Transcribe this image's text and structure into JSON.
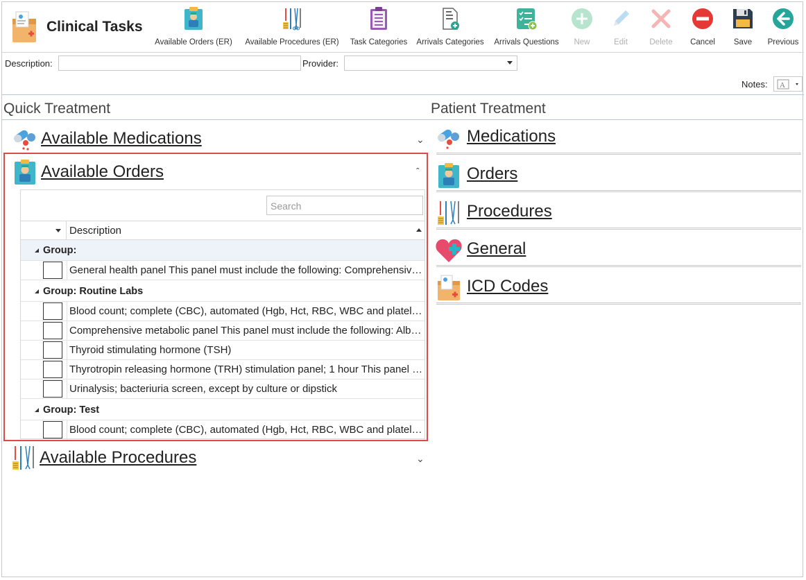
{
  "app": {
    "title": "Clinical Tasks"
  },
  "toolbar": {
    "buttons": [
      {
        "label": "Available Orders (ER)",
        "icon": "orders-clipboard-icon"
      },
      {
        "label": "Available Procedures (ER)",
        "icon": "surgical-tools-icon"
      },
      {
        "label": "Task Categories",
        "icon": "list-clipboard-icon"
      },
      {
        "label": "Arrivals Categories",
        "icon": "document-add-icon"
      },
      {
        "label": "Arrivals Questions",
        "icon": "checklist-add-icon"
      },
      {
        "label": "New",
        "icon": "plus-circle-icon",
        "enabled": false
      },
      {
        "label": "Edit",
        "icon": "pencil-icon",
        "enabled": false
      },
      {
        "label": "Delete",
        "icon": "x-icon",
        "enabled": false
      },
      {
        "label": "Cancel",
        "icon": "minus-circle-icon",
        "enabled": true
      },
      {
        "label": "Save",
        "icon": "floppy-disk-icon",
        "enabled": true
      },
      {
        "label": "Previous",
        "icon": "arrow-left-circle-icon",
        "enabled": true
      }
    ]
  },
  "filters": {
    "description_label": "Description:",
    "description_value": "",
    "provider_label": "Provider:",
    "provider_value": "",
    "notes_label": "Notes:"
  },
  "quick_treatment": {
    "title": "Quick Treatment",
    "sections": {
      "medications": {
        "label": "Available Medications",
        "expanded": false
      },
      "orders": {
        "label": "Available Orders",
        "expanded": true
      },
      "procedures": {
        "label": "Available Procedures",
        "expanded": false
      }
    },
    "orders_grid": {
      "search_placeholder": "Search",
      "column_header": "Description",
      "groups": [
        {
          "label": "Group:",
          "rows": [
            {
              "text": "General health panel This panel must include the following: Comprehensive metabolic panel",
              "checked": false
            }
          ]
        },
        {
          "label": "Group: Routine Labs",
          "rows": [
            {
              "text": "Blood count; complete (CBC), automated (Hgb, Hct, RBC, WBC and platelet count)",
              "checked": false
            },
            {
              "text": "Comprehensive metabolic panel This panel must include the following: Albumin",
              "checked": false
            },
            {
              "text": "Thyroid stimulating hormone (TSH)",
              "checked": false
            },
            {
              "text": "Thyrotropin releasing hormone (TRH) stimulation panel; 1 hour This panel must include",
              "checked": false
            },
            {
              "text": "Urinalysis; bacteriuria screen, except by culture or dipstick",
              "checked": false
            }
          ]
        },
        {
          "label": "Group: Test",
          "rows": [
            {
              "text": "Blood count; complete (CBC), automated (Hgb, Hct, RBC, WBC and platelet count)",
              "checked": false
            }
          ]
        }
      ]
    }
  },
  "patient_treatment": {
    "title": "Patient Treatment",
    "items": [
      {
        "label": "Medications",
        "icon": "pills-icon"
      },
      {
        "label": "Orders",
        "icon": "orders-clipboard-icon"
      },
      {
        "label": "Procedures",
        "icon": "surgical-tools-icon"
      },
      {
        "label": "General",
        "icon": "heart-cross-icon"
      },
      {
        "label": "ICD Codes",
        "icon": "medical-folder-icon"
      }
    ]
  },
  "colors": {
    "highlight": "#e04747",
    "rule": "#b9c6d4",
    "disabled_label": "#b0b0b0"
  }
}
